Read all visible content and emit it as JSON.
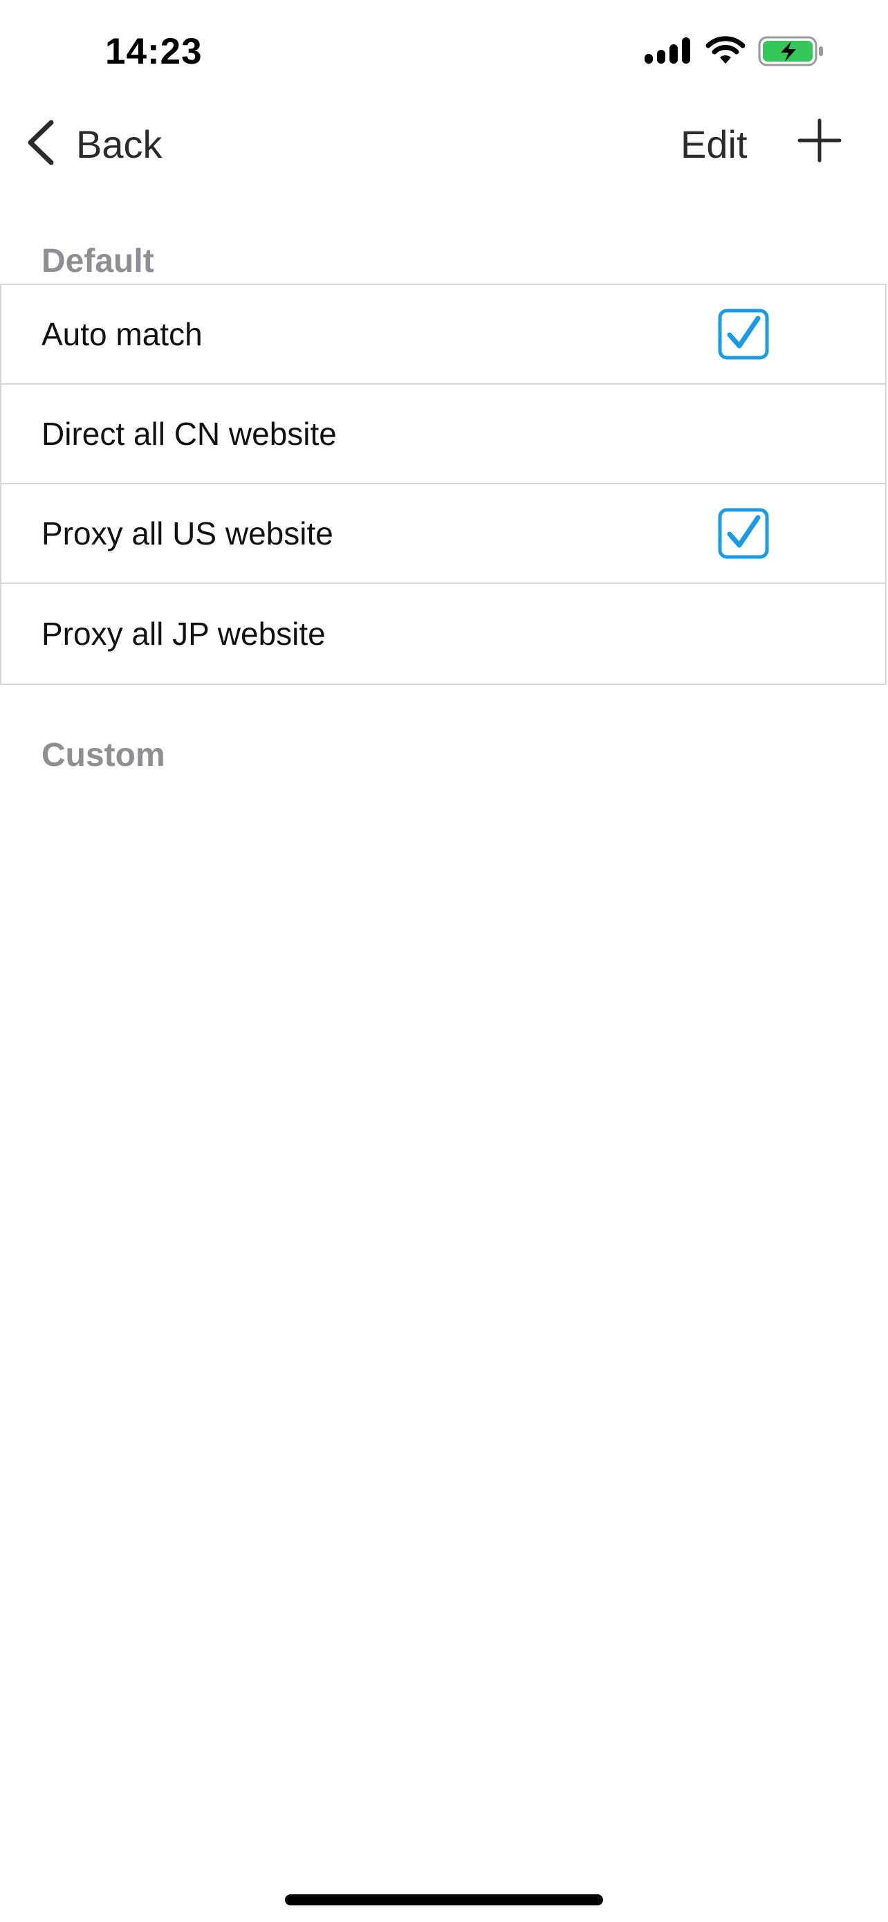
{
  "status_bar": {
    "time": "14:23",
    "icons": [
      "cellular-signal-icon",
      "wifi-icon",
      "battery-charging-icon"
    ]
  },
  "nav": {
    "back_label": "Back",
    "edit_label": "Edit",
    "add_icon": "plus-icon"
  },
  "sections": {
    "default": {
      "header": "Default",
      "rows": [
        {
          "label": "Auto match",
          "checked": true
        },
        {
          "label": "Direct all CN website",
          "checked": false
        },
        {
          "label": "Proxy all US website",
          "checked": true
        },
        {
          "label": "Proxy all JP website",
          "checked": false
        }
      ]
    },
    "custom": {
      "header": "Custom",
      "rows": []
    }
  },
  "colors": {
    "accent": "#1a9be6",
    "battery_green": "#34c759",
    "section_header": "#8e8e93",
    "separator": "#d6d6d6"
  }
}
